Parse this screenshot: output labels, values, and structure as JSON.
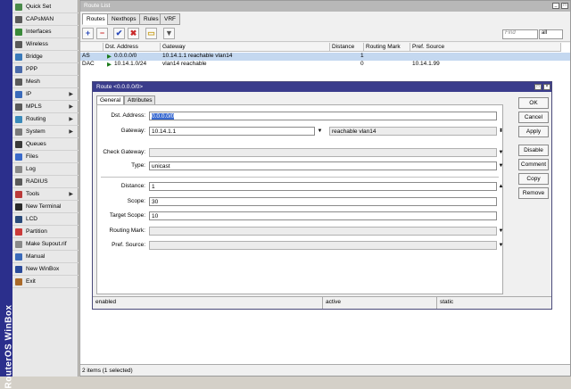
{
  "brand": {
    "text": "RouterOS WinBox"
  },
  "sidebar": {
    "items": [
      {
        "label": "Quick Set",
        "icon": "quick-set-icon",
        "color": "#4a8a4a",
        "submenu": false
      },
      {
        "label": "CAPsMAN",
        "icon": "capsman-icon",
        "color": "#5a5a5a",
        "submenu": false
      },
      {
        "label": "Interfaces",
        "icon": "interfaces-icon",
        "color": "#3a8a3a",
        "submenu": false
      },
      {
        "label": "Wireless",
        "icon": "wireless-icon",
        "color": "#5a5a5a",
        "submenu": false
      },
      {
        "label": "Bridge",
        "icon": "bridge-icon",
        "color": "#3a7aba",
        "submenu": false
      },
      {
        "label": "PPP",
        "icon": "ppp-icon",
        "color": "#4a6aaa",
        "submenu": false
      },
      {
        "label": "Mesh",
        "icon": "mesh-icon",
        "color": "#5a5a5a",
        "submenu": false
      },
      {
        "label": "IP",
        "icon": "ip-icon",
        "color": "#3a6aba",
        "submenu": true
      },
      {
        "label": "MPLS",
        "icon": "mpls-icon",
        "color": "#5a5a5a",
        "submenu": true
      },
      {
        "label": "Routing",
        "icon": "routing-icon",
        "color": "#3a8aba",
        "submenu": true
      },
      {
        "label": "System",
        "icon": "system-icon",
        "color": "#7a7a7a",
        "submenu": true
      },
      {
        "label": "Queues",
        "icon": "queues-icon",
        "color": "#3a3a3a",
        "submenu": false
      },
      {
        "label": "Files",
        "icon": "files-icon",
        "color": "#3a6aca",
        "submenu": false
      },
      {
        "label": "Log",
        "icon": "log-icon",
        "color": "#8a8a8a",
        "submenu": false
      },
      {
        "label": "RADIUS",
        "icon": "radius-icon",
        "color": "#5a5a5a",
        "submenu": false
      },
      {
        "label": "Tools",
        "icon": "tools-icon",
        "color": "#ba3a3a",
        "submenu": true
      },
      {
        "label": "New Terminal",
        "icon": "terminal-icon",
        "color": "#2a2a2a",
        "submenu": false
      },
      {
        "label": "LCD",
        "icon": "lcd-icon",
        "color": "#2a4a7a",
        "submenu": false
      },
      {
        "label": "Partition",
        "icon": "partition-icon",
        "color": "#ca3a3a",
        "submenu": false
      },
      {
        "label": "Make Supout.rif",
        "icon": "supout-icon",
        "color": "#8a8a8a",
        "submenu": false
      },
      {
        "label": "Manual",
        "icon": "manual-icon",
        "color": "#3a6aba",
        "submenu": false
      },
      {
        "label": "New WinBox",
        "icon": "winbox-icon",
        "color": "#2a4a9a",
        "submenu": false
      },
      {
        "label": "Exit",
        "icon": "exit-icon",
        "color": "#aa6a2a",
        "submenu": false
      }
    ]
  },
  "window": {
    "title": "Route List",
    "minimize": "_",
    "close": "□"
  },
  "tabs": [
    {
      "label": "Routes"
    },
    {
      "label": "Nexthops"
    },
    {
      "label": "Rules"
    },
    {
      "label": "VRF"
    }
  ],
  "toolbar": {
    "add": "+",
    "remove": "−",
    "enable": "✔",
    "disable": "✖",
    "comment": "▭",
    "filter": "▼",
    "find_placeholder": "Find",
    "scope": "all"
  },
  "table": {
    "headers": [
      "",
      "Dst. Address",
      "Gateway",
      "Distance",
      "Routing Mark",
      "Pref. Source"
    ],
    "rows": [
      {
        "flags": "AS",
        "dst": "0.0.0.0/0",
        "gateway": "10.14.1.1 reachable vlan14",
        "distance": "1",
        "mark": "",
        "pref": ""
      },
      {
        "flags": "DAC",
        "dst": "10.14.1.0/24",
        "gateway": "vlan14 reachable",
        "distance": "0",
        "mark": "",
        "pref": "10.14.1.99"
      }
    ],
    "status": "2 items (1 selected)"
  },
  "dialog": {
    "title": "Route <0.0.0.0/0>",
    "tabs": [
      {
        "label": "General"
      },
      {
        "label": "Attributes"
      }
    ],
    "labels": {
      "dst": "Dst. Address:",
      "gateway": "Gateway:",
      "check_gateway": "Check Gateway:",
      "type": "Type:",
      "distance": "Distance:",
      "scope": "Scope:",
      "target_scope": "Target Scope:",
      "routing_mark": "Routing Mark:",
      "pref_source": "Pref. Source:"
    },
    "values": {
      "dst": "0.0.0.0/0",
      "gateway": "10.14.1.1",
      "gateway_status": "reachable vlan14",
      "check_gateway": "",
      "type": "unicast",
      "distance": "1",
      "scope": "30",
      "target_scope": "10",
      "routing_mark": "",
      "pref_source": ""
    },
    "buttons": {
      "ok": "OK",
      "cancel": "Cancel",
      "apply": "Apply",
      "disable": "Disable",
      "comment": "Comment",
      "copy": "Copy",
      "remove": "Remove"
    },
    "status": [
      "enabled",
      "active",
      "static"
    ]
  },
  "colors": {
    "accent": "#3a3c8c",
    "selection": "#c4d8f0",
    "brand": "#2b2f8c"
  }
}
